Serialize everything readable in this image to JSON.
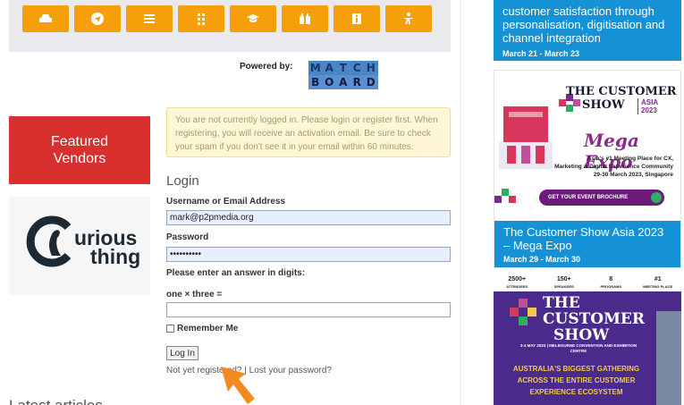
{
  "nav": {
    "icons": [
      "car-icon",
      "send-icon",
      "list-icon",
      "grid-icon",
      "graduation-cap-icon",
      "binoculars-icon",
      "info-icon",
      "person-icon"
    ],
    "color": "#f5a00a"
  },
  "powered": {
    "label": "Powered by:",
    "logo_top": [
      "M",
      "A",
      "T",
      "C",
      "H"
    ],
    "logo_bottom": [
      "B",
      "O",
      "A",
      "R",
      "D"
    ]
  },
  "left": {
    "featured_label": "Featured Vendors",
    "vendor_name_line1": "urious",
    "vendor_name_line2": "thing",
    "latest_heading": "Latest articles"
  },
  "login": {
    "notice": "You are not currently logged in. Please login or register first. When registering, you will receive an activation email. Be sure to check your spam if you don't see it in your email within 60 minutes.",
    "title": "Login",
    "username_label": "Username or Email Address",
    "username_value": "mark@p2pmedia.org",
    "password_label": "Password",
    "password_value": "••••••••••",
    "captcha_label": "Please enter an answer in digits:",
    "captcha_question": "one × three =",
    "captcha_value": "",
    "remember_label": "Remember Me",
    "login_button": "Log In",
    "register_link": "Not yet registered?",
    "separator": "|",
    "lost_password_link": "Lost your password?"
  },
  "ads": {
    "ad1": {
      "title": "customer satisfaction through personalisation, digitisation and channel integration",
      "date": "March 21 - March 23"
    },
    "ad2": {
      "logo_line1": "THE CUSTOMER",
      "logo_line2": "SHOW",
      "region_line1": "ASIA",
      "region_line2": "2023",
      "mega": "Mega Expo",
      "sub1": "Asia's #1 Meeting Place for CX,",
      "sub2": "Marketing & Digital Experience Community",
      "sub3": "29-30 March 2023, Singapore",
      "button": "GET YOUR EVENT BROCHURE",
      "caption_title": "The Customer Show Asia 2023 – Mega Expo",
      "caption_date": "March 29 - March 30"
    },
    "ad3": {
      "stats": [
        {
          "value": "2500+",
          "label": "ATTENDEES"
        },
        {
          "value": "150+",
          "label": "SPEAKERS"
        },
        {
          "value": "8",
          "label": "PROGRAMS"
        },
        {
          "value": "#1",
          "label": "MEETING PLACE"
        }
      ],
      "logo_line1": "THE CUSTOMER",
      "logo_line2": "SHOW",
      "date_line": "3-4 MAY 2023 | MELBOURNE CONVENTION AND EXHIBITION CENTRE",
      "tagline": "AUSTRALIA'S BIGGEST GATHERING ACROSS THE ENTIRE CUSTOMER EXPERIENCE ECOSYSTEM"
    },
    "blue": "#1592d6",
    "purple": "#4a2a8a"
  }
}
